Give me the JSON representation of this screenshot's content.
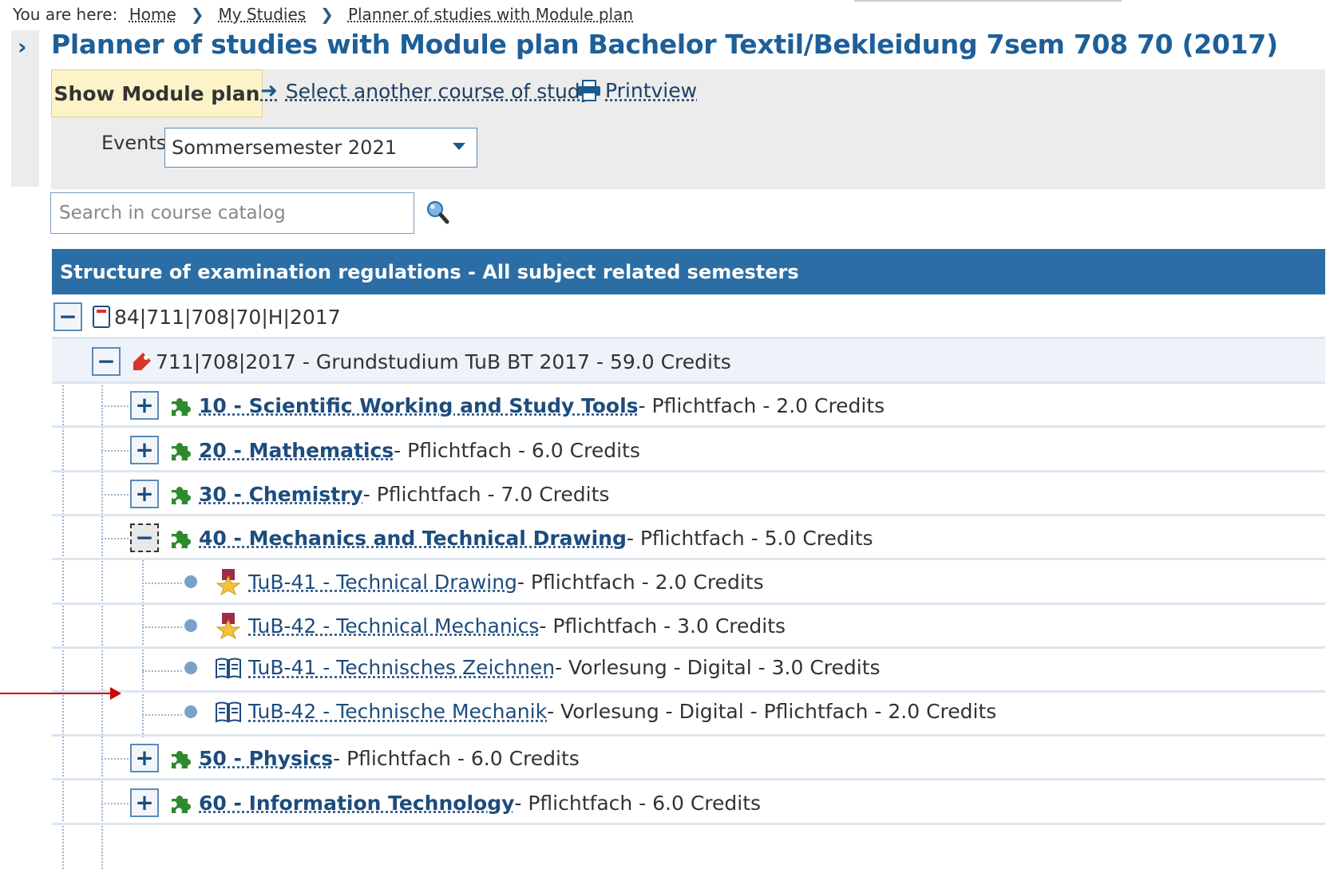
{
  "breadcrumb": {
    "prefix": "You are here:",
    "items": [
      "Home",
      "My Studies",
      "Planner of studies with Module plan"
    ]
  },
  "page_title": "Planner of studies with Module plan Bachelor Textil/Bekleidung 7sem 708 70 (2017)",
  "toolbar": {
    "show_module_plan": "Show Module plan",
    "select_course": "Select another course of study",
    "printview": "Printview",
    "events_label": "Events",
    "events_value": "Sommersemester 2021"
  },
  "search": {
    "placeholder": "Search in course catalog"
  },
  "tree": {
    "header": "Structure of examination regulations - All subject related semesters",
    "rows": [
      {
        "toggle": "−",
        "title": "84|711|708|70|H|2017",
        "rest": ""
      },
      {
        "toggle": "−",
        "title": "711|708|2017 - Grundstudium TuB BT 2017 - 59.0 Credits",
        "rest": ""
      },
      {
        "toggle": "+",
        "title": "10 - Scientific Working and Study Tools",
        "rest": " - Pflichtfach - 2.0 Credits"
      },
      {
        "toggle": "+",
        "title": "20 - Mathematics",
        "rest": " - Pflichtfach - 6.0 Credits"
      },
      {
        "toggle": "+",
        "title": "30 - Chemistry",
        "rest": " - Pflichtfach - 7.0 Credits"
      },
      {
        "toggle": "−",
        "title": "40 - Mechanics and Technical Drawing",
        "rest": " - Pflichtfach - 5.0 Credits"
      },
      {
        "title": "TuB-41 - Technical Drawing",
        "rest": " - Pflichtfach - 2.0 Credits"
      },
      {
        "title": "TuB-42 - Technical Mechanics",
        "rest": " - Pflichtfach - 3.0 Credits"
      },
      {
        "title": "TuB-41 - Technisches Zeichnen",
        "rest": " - Vorlesung - Digital - 3.0 Credits"
      },
      {
        "title": "TuB-42 - Technische Mechanik",
        "rest": " - Vorlesung - Digital - Pflichtfach - 2.0 Credits"
      },
      {
        "toggle": "+",
        "title": "50 - Physics",
        "rest": " - Pflichtfach - 6.0 Credits"
      },
      {
        "toggle": "+",
        "title": "60 - Information Technology",
        "rest": " - Pflichtfach - 6.0 Credits"
      }
    ]
  },
  "colors": {
    "accent": "#2b6ea5",
    "title": "#1d5f98",
    "button": "#fcf4c8",
    "arrow": "#d00000"
  }
}
